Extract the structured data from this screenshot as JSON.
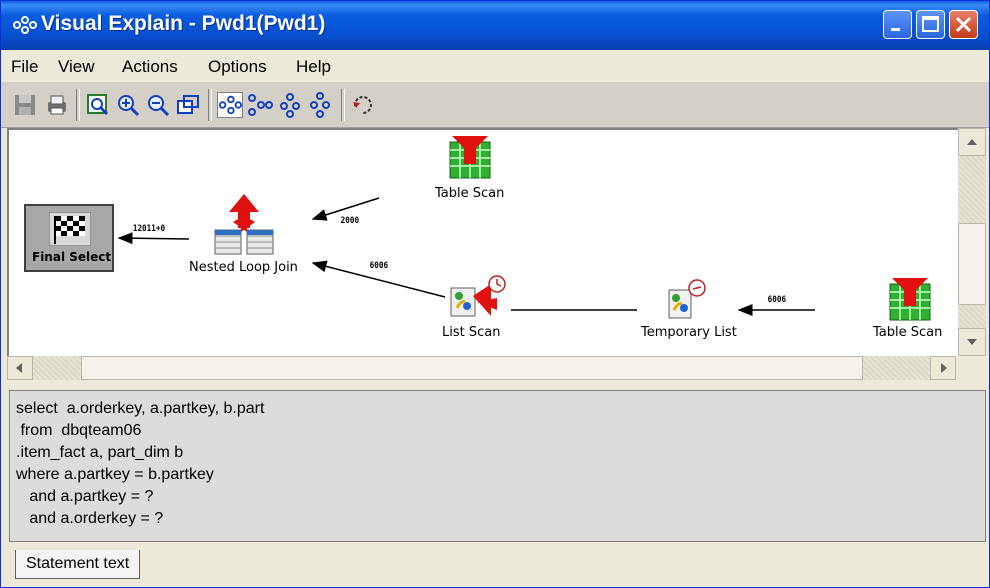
{
  "window": {
    "title": "Visual Explain - Pwd1(Pwd1)",
    "controls": [
      "minimize-icon",
      "maximize-icon",
      "close-icon"
    ]
  },
  "menu": {
    "items": [
      "File",
      "View",
      "Actions",
      "Options",
      "Help"
    ]
  },
  "toolbar": {
    "icons": [
      "save-icon",
      "print-icon",
      "zoom-to-fit-icon",
      "zoom-in-icon",
      "zoom-out-icon",
      "overview-icon",
      "graph-right-to-left-icon",
      "graph-left-to-right-icon",
      "graph-top-to-bottom-icon",
      "graph-bottom-to-top-icon",
      "refresh-icon"
    ]
  },
  "graph": {
    "nodes": [
      {
        "id": "final-select",
        "label": "Final Select",
        "icon": "checkered-flag-icon"
      },
      {
        "id": "nested-loop-join",
        "label": "Nested Loop Join",
        "icon": "nested-loop-join-icon"
      },
      {
        "id": "table-scan-1",
        "label": "Table Scan",
        "icon": "table-scan-icon"
      },
      {
        "id": "list-scan",
        "label": "List Scan",
        "icon": "list-scan-icon"
      },
      {
        "id": "temporary-list",
        "label": "Temporary List",
        "icon": "temporary-list-icon"
      },
      {
        "id": "table-scan-2",
        "label": "Table Scan",
        "icon": "table-scan-icon"
      }
    ],
    "edges": [
      {
        "from": "nested-loop-join",
        "to": "final-select",
        "label": "12011+0"
      },
      {
        "from": "table-scan-1",
        "to": "nested-loop-join",
        "label": "2000"
      },
      {
        "from": "list-scan",
        "to": "nested-loop-join",
        "label": "6006"
      },
      {
        "from": "table-scan-2",
        "to": "temporary-list",
        "label": "6006"
      }
    ]
  },
  "statement": {
    "text": "select  a.orderkey, a.partkey, b.part\n from  dbqteam06\n.item_fact a, part_dim b\nwhere a.partkey = b.partkey\n   and a.partkey = ?\n   and a.orderkey = ?"
  },
  "tabs": {
    "statement_text": "Statement text"
  },
  "colors": {
    "title_bar": "#0a5ce0",
    "scan_arrow": "#e01010",
    "table_grid": "#1a9a1a"
  }
}
